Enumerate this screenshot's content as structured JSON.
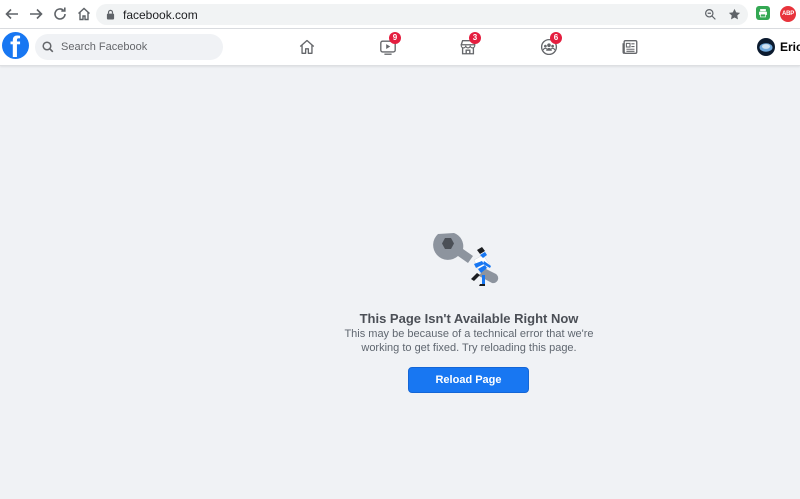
{
  "browser": {
    "url": "facebook.com",
    "extensions": {
      "abp_label": "ABP"
    }
  },
  "header": {
    "search": {
      "placeholder": "Search Facebook"
    },
    "tabs": [
      {
        "name": "home",
        "badge": ""
      },
      {
        "name": "watch",
        "badge": "9"
      },
      {
        "name": "marketplace",
        "badge": "3"
      },
      {
        "name": "groups",
        "badge": "6"
      },
      {
        "name": "news-feed",
        "badge": ""
      }
    ],
    "profile": {
      "name": "Eric"
    }
  },
  "error": {
    "title": "This Page Isn't Available Right Now",
    "message": "This may be because of a technical error that we're working to get fixed. Try reloading this page.",
    "button_label": "Reload Page"
  },
  "colors": {
    "brand": "#1877f2",
    "badge": "#e41e3f",
    "background": "#f0f2f5"
  }
}
